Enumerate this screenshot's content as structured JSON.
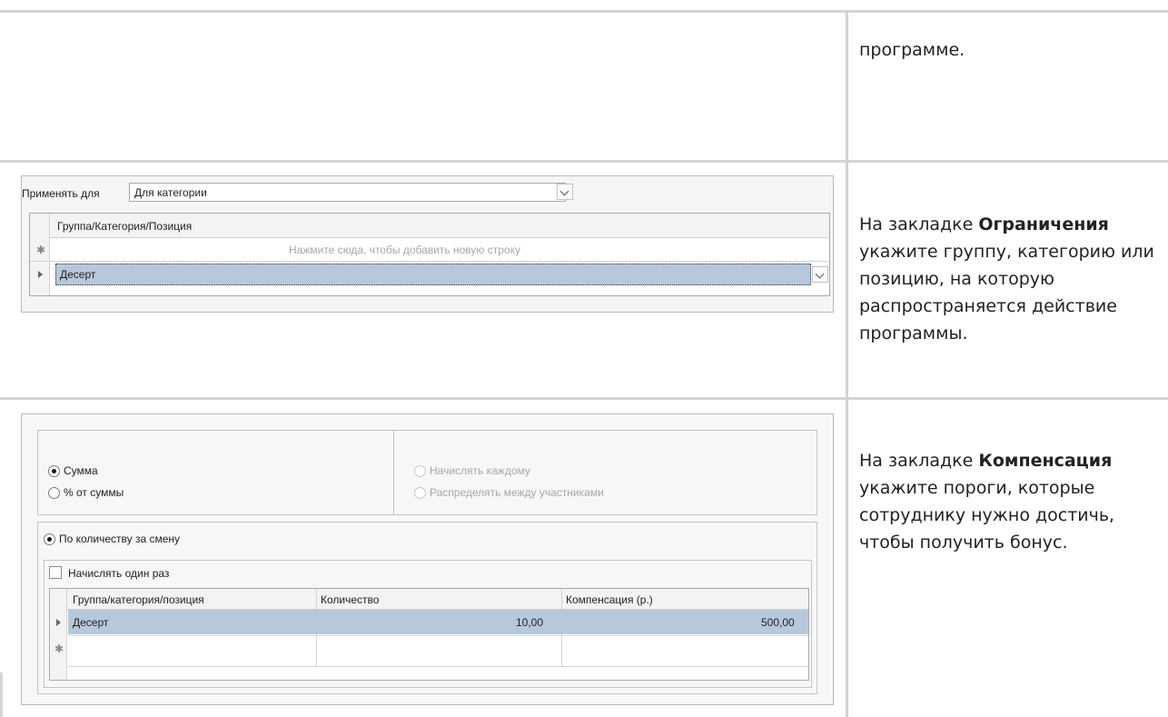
{
  "row1": {
    "text": "программе."
  },
  "row2": {
    "apply_label": "Применять для",
    "apply_value": "Для категории",
    "column_header": "Группа/Категория/Позиция",
    "new_row_hint": "Нажмите сюда, чтобы добавить новую строку",
    "selected_item": "Десерт",
    "desc_pre": "На закладке ",
    "desc_bold": "Ограничения",
    "desc_post": " укажите группу, категорию или позицию, на которую распространяется действие программы."
  },
  "row3": {
    "radio_sum": "Сумма",
    "radio_percent": "% от суммы",
    "radio_each": "Начислять каждому",
    "radio_distribute": "Распределять между участниками",
    "radio_by_quantity": "По количеству за смену",
    "check_once": "Начислять один раз",
    "columns": [
      "Группа/категория/позиция",
      "Количество",
      "Компенсация (р.)"
    ],
    "row": {
      "item": "Десерт",
      "quantity": "10,00",
      "compensation": "500,00"
    },
    "desc_pre": "На закладке ",
    "desc_bold": "Компенсация",
    "desc_post": " укажите пороги, которые сотруднику нужно достичь, чтобы получить бонус."
  }
}
